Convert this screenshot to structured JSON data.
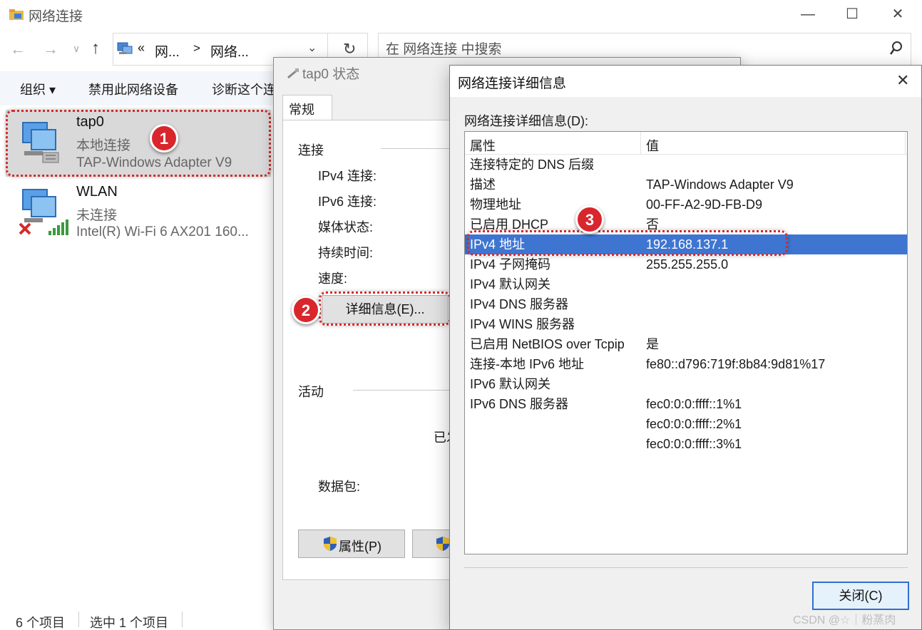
{
  "explorer": {
    "title": "网络连接",
    "breadcrumb": {
      "prefix": "«",
      "crumb1": "网...",
      "sep": ">",
      "crumb2": "网络..."
    },
    "search_placeholder": "在 网络连接 中搜索",
    "commands": {
      "organize": "组织 ▾",
      "disable": "禁用此网络设备",
      "diagnose": "诊断这个连"
    },
    "items": [
      {
        "name": "tap0",
        "status": "本地连接",
        "device": "TAP-Windows Adapter V9"
      },
      {
        "name": "WLAN",
        "status": "未连接",
        "device": "Intel(R) Wi-Fi 6 AX201 160..."
      }
    ],
    "statusbar": {
      "count": "6 个项目",
      "selected": "选中 1 个项目"
    }
  },
  "status_dialog": {
    "title": "tap0 状态",
    "tab": "常规",
    "connection_group": "连接",
    "fields": [
      "IPv4 连接:",
      "IPv6 连接:",
      "媒体状态:",
      "持续时间:",
      "速度:"
    ],
    "details_button": "详细信息(E)...",
    "activity_group": "活动",
    "sent_partial": "已发",
    "packets": "数据包:",
    "properties_button": "属性(P)"
  },
  "details_dialog": {
    "title": "网络连接详细信息",
    "list_label": "网络连接详细信息(D):",
    "header": {
      "prop": "属性",
      "val": "值"
    },
    "rows": [
      {
        "k": "连接特定的 DNS 后缀",
        "v": ""
      },
      {
        "k": "描述",
        "v": "TAP-Windows Adapter V9"
      },
      {
        "k": "物理地址",
        "v": "00-FF-A2-9D-FB-D9"
      },
      {
        "k": "已启用 DHCP",
        "v": "否"
      },
      {
        "k": "IPv4 地址",
        "v": "192.168.137.1"
      },
      {
        "k": "IPv4 子网掩码",
        "v": "255.255.255.0"
      },
      {
        "k": "IPv4 默认网关",
        "v": ""
      },
      {
        "k": "IPv4 DNS 服务器",
        "v": ""
      },
      {
        "k": "IPv4 WINS 服务器",
        "v": ""
      },
      {
        "k": "已启用 NetBIOS over Tcpip",
        "v": "是"
      },
      {
        "k": "连接-本地 IPv6 地址",
        "v": "fe80::d796:719f:8b84:9d81%17"
      },
      {
        "k": "IPv6 默认网关",
        "v": ""
      },
      {
        "k": "IPv6 DNS 服务器",
        "v": "fec0:0:0:ffff::1%1"
      },
      {
        "k": "",
        "v": "fec0:0:0:ffff::2%1"
      },
      {
        "k": "",
        "v": "fec0:0:0:ffff::3%1"
      }
    ],
    "selected_row": 4,
    "close_button": "关闭(C)"
  },
  "annotations": {
    "step1": "1",
    "step2": "2",
    "step3": "3"
  },
  "watermark": "CSDN @☆｜粉蒸肉",
  "colors": {
    "selection": "#3e75d1",
    "badge": "#d8262c",
    "highlight": "#d12a2a"
  }
}
